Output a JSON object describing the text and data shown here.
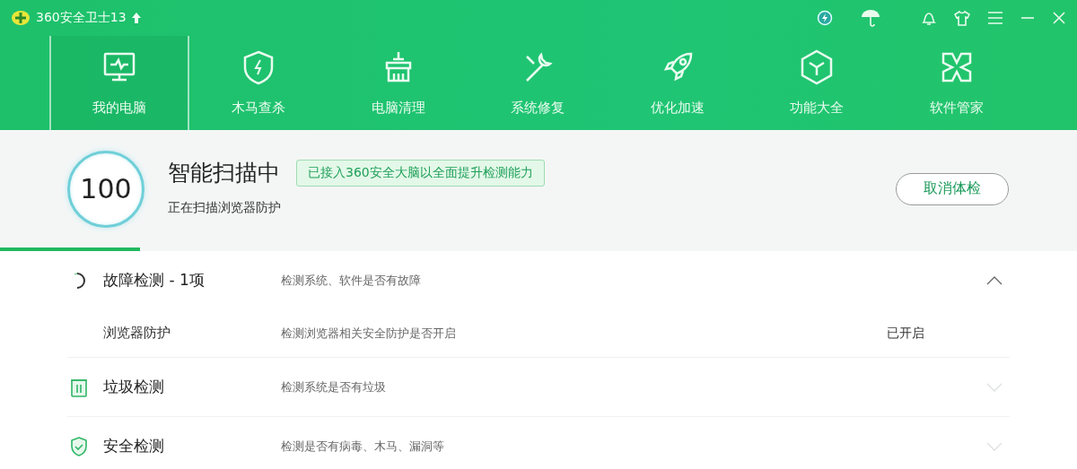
{
  "window": {
    "title": "360安全卫士13"
  },
  "nav_tabs": [
    {
      "label": "我的电脑",
      "selected": true
    },
    {
      "label": "木马查杀",
      "selected": false
    },
    {
      "label": "电脑清理",
      "selected": false
    },
    {
      "label": "系统修复",
      "selected": false
    },
    {
      "label": "优化加速",
      "selected": false
    },
    {
      "label": "功能大全",
      "selected": false
    },
    {
      "label": "软件管家",
      "selected": false
    }
  ],
  "scan": {
    "score": "100",
    "title": "智能扫描中",
    "badge": "已接入360安全大脑以全面提升检测能力",
    "status": "正在扫描浏览器防护",
    "cancel_button": "取消体检",
    "level": 0.13
  },
  "sections": [
    {
      "kind": "scanning",
      "title": "故障检测 - 1项",
      "description": "检测系统、软件是否有故障",
      "expanded": true,
      "children": [
        {
          "title": "浏览器防护",
          "description": "检测浏览器相关安全防护是否开启",
          "status": "已开启"
        }
      ]
    },
    {
      "kind": "trash",
      "title": "垃圾检测",
      "description": "检测系统是否有垃圾",
      "expanded": false
    },
    {
      "kind": "shield",
      "title": "安全检测",
      "description": "检测是否有病毒、木马、漏洞等",
      "expanded": false
    }
  ]
}
